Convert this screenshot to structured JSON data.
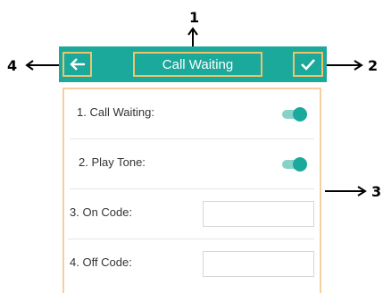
{
  "callouts": {
    "n1": "1",
    "n2": "2",
    "n3": "3",
    "n4": "4"
  },
  "titlebar": {
    "title": "Call Waiting",
    "back_icon": "arrow-left-icon",
    "ok_icon": "check-icon",
    "color": "#1aa99b",
    "highlight_color": "#f0c36a"
  },
  "settings": {
    "call_waiting_label": "1. Call Waiting:",
    "call_waiting_enabled": true,
    "play_tone_label": "2. Play Tone:",
    "play_tone_enabled": true,
    "on_code_label": "3. On Code:",
    "on_code_value": "",
    "off_code_label": "4. Off Code:",
    "off_code_value": ""
  }
}
